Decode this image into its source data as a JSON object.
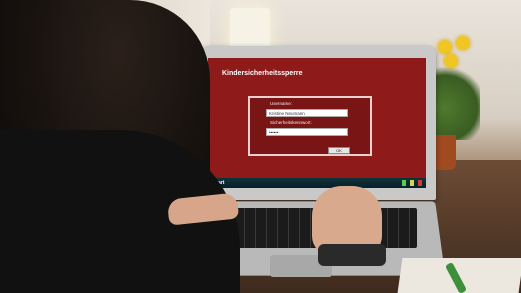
{
  "screen": {
    "app_title": "Kindersicherheitssperre",
    "dialog": {
      "username_label": "Username:",
      "username_value": "Kristine Neumann",
      "password_label": "Sicherheitskennwort:",
      "password_value": "••••••",
      "ok_label": "OK"
    },
    "taskbar": {
      "start_label": "Start"
    }
  },
  "colors": {
    "screen_bg": "#8e1a1a",
    "dialog_bg": "#7a1515",
    "taskbar": "#0b2a33",
    "flower": "#f0c624"
  }
}
